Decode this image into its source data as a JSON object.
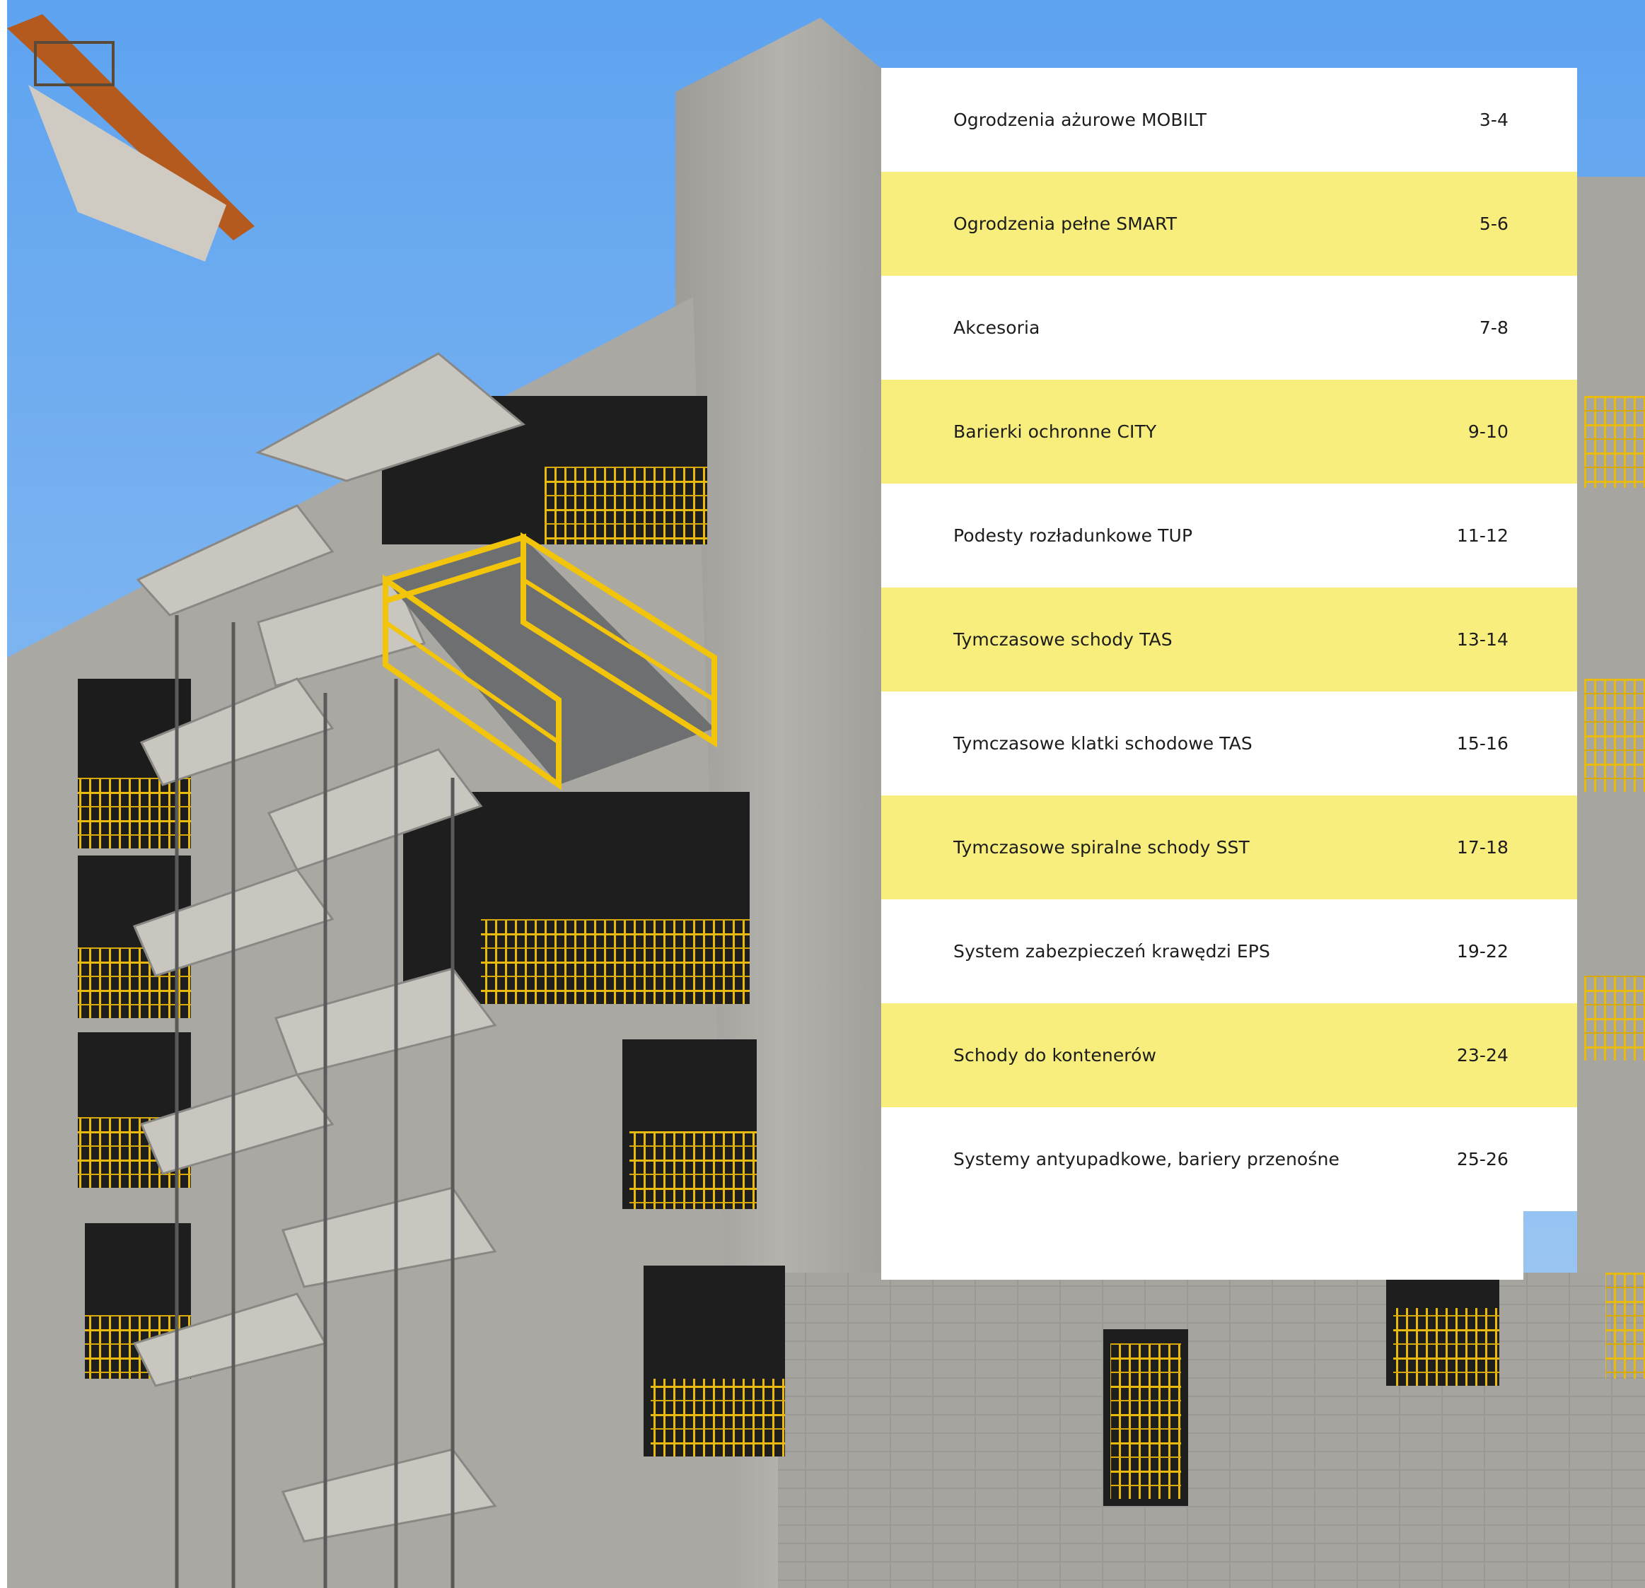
{
  "toc": [
    {
      "title": "Ogrodzenia ażurowe MOBILT",
      "pages": "3-4",
      "highlight": false
    },
    {
      "title": "Ogrodzenia pełne SMART",
      "pages": "5-6",
      "highlight": true
    },
    {
      "title": "Akcesoria",
      "pages": "7-8",
      "highlight": false
    },
    {
      "title": "Barierki ochronne CITY",
      "pages": "9-10",
      "highlight": true
    },
    {
      "title": "Podesty rozładunkowe TUP",
      "pages": "11-12",
      "highlight": false
    },
    {
      "title": "Tymczasowe schody TAS",
      "pages": "13-14",
      "highlight": true
    },
    {
      "title": "Tymczasowe klatki schodowe TAS",
      "pages": "15-16",
      "highlight": false
    },
    {
      "title": "Tymczasowe spiralne schody SST",
      "pages": "17-18",
      "highlight": true
    },
    {
      "title": "System zabezpieczeń krawędzi EPS",
      "pages": "19-22",
      "highlight": false
    },
    {
      "title": "Schody do kontenerów",
      "pages": "23-24",
      "highlight": true
    },
    {
      "title": "Systemy antyupadkowe, bariery przenośne",
      "pages": "25-26",
      "highlight": false
    }
  ],
  "colors": {
    "highlight": "#f8ee7d",
    "sky": "#6aaaf0",
    "concrete": "#a9a7a3",
    "railing": "#f1c10c"
  }
}
